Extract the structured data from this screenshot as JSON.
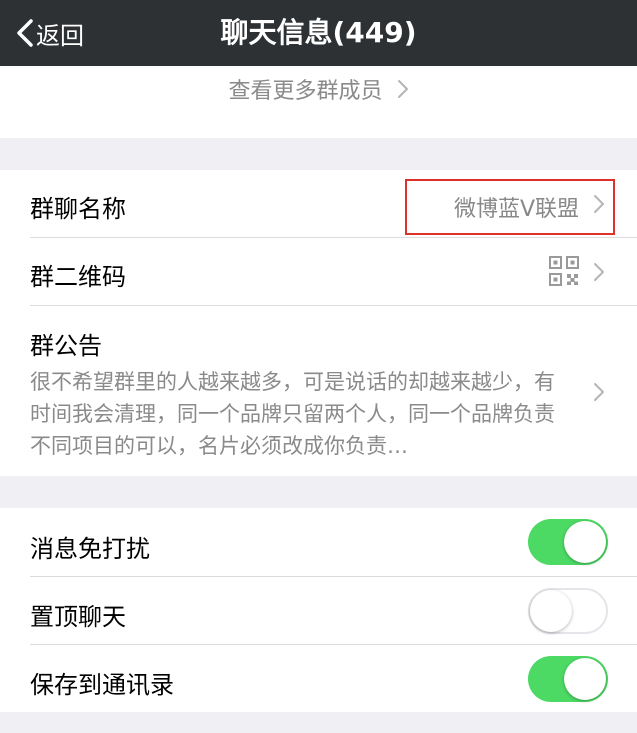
{
  "nav": {
    "back_label": "返回",
    "title": "聊天信息(449)"
  },
  "members": {
    "more_label": "查看更多群成员"
  },
  "group_info": {
    "name_label": "群聊名称",
    "name_value": "微博蓝V联盟",
    "qr_label": "群二维码",
    "notice_label": "群公告",
    "notice_text": "很不希望群里的人越来越多，可是说话的却越来越少，有时间我会清理，同一个品牌只留两个人，同一个品牌负责不同项目的可以，名片必须改成你负责…"
  },
  "settings": {
    "mute_label": "消息免打扰",
    "mute_on": true,
    "pin_label": "置顶聊天",
    "pin_on": false,
    "save_label": "保存到通讯录",
    "save_on": true
  },
  "colors": {
    "nav_bg": "#2e3134",
    "toggle_on": "#4cd964",
    "highlight": "#e0302c"
  }
}
